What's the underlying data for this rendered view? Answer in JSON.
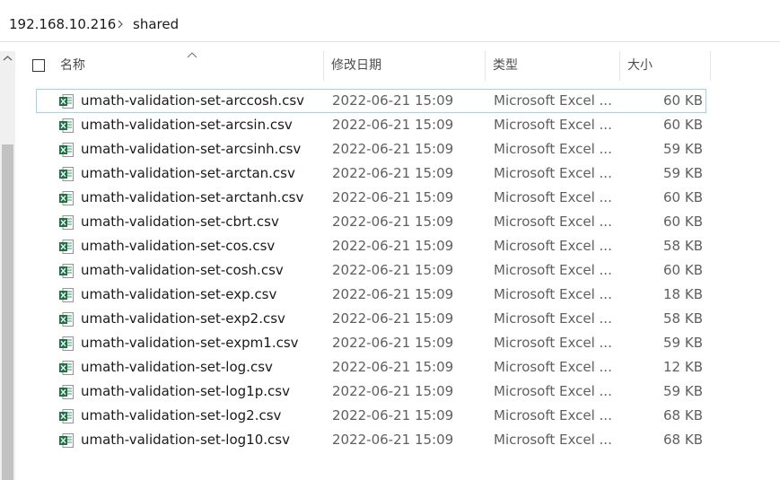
{
  "breadcrumb": {
    "items": [
      "192.168.10.216",
      "shared"
    ]
  },
  "columns": {
    "name": "名称",
    "date": "修改日期",
    "type": "类型",
    "size": "大小"
  },
  "files": [
    {
      "name": "umath-validation-set-arccosh.csv",
      "date": "2022-06-21 15:09",
      "type": "Microsoft Excel ...",
      "size": "60 KB"
    },
    {
      "name": "umath-validation-set-arcsin.csv",
      "date": "2022-06-21 15:09",
      "type": "Microsoft Excel ...",
      "size": "60 KB"
    },
    {
      "name": "umath-validation-set-arcsinh.csv",
      "date": "2022-06-21 15:09",
      "type": "Microsoft Excel ...",
      "size": "59 KB"
    },
    {
      "name": "umath-validation-set-arctan.csv",
      "date": "2022-06-21 15:09",
      "type": "Microsoft Excel ...",
      "size": "59 KB"
    },
    {
      "name": "umath-validation-set-arctanh.csv",
      "date": "2022-06-21 15:09",
      "type": "Microsoft Excel ...",
      "size": "60 KB"
    },
    {
      "name": "umath-validation-set-cbrt.csv",
      "date": "2022-06-21 15:09",
      "type": "Microsoft Excel ...",
      "size": "60 KB"
    },
    {
      "name": "umath-validation-set-cos.csv",
      "date": "2022-06-21 15:09",
      "type": "Microsoft Excel ...",
      "size": "58 KB"
    },
    {
      "name": "umath-validation-set-cosh.csv",
      "date": "2022-06-21 15:09",
      "type": "Microsoft Excel ...",
      "size": "60 KB"
    },
    {
      "name": "umath-validation-set-exp.csv",
      "date": "2022-06-21 15:09",
      "type": "Microsoft Excel ...",
      "size": "18 KB"
    },
    {
      "name": "umath-validation-set-exp2.csv",
      "date": "2022-06-21 15:09",
      "type": "Microsoft Excel ...",
      "size": "58 KB"
    },
    {
      "name": "umath-validation-set-expm1.csv",
      "date": "2022-06-21 15:09",
      "type": "Microsoft Excel ...",
      "size": "59 KB"
    },
    {
      "name": "umath-validation-set-log.csv",
      "date": "2022-06-21 15:09",
      "type": "Microsoft Excel ...",
      "size": "12 KB"
    },
    {
      "name": "umath-validation-set-log1p.csv",
      "date": "2022-06-21 15:09",
      "type": "Microsoft Excel ...",
      "size": "59 KB"
    },
    {
      "name": "umath-validation-set-log2.csv",
      "date": "2022-06-21 15:09",
      "type": "Microsoft Excel ...",
      "size": "68 KB"
    },
    {
      "name": "umath-validation-set-log10.csv",
      "date": "2022-06-21 15:09",
      "type": "Microsoft Excel ...",
      "size": "68 KB"
    }
  ],
  "icons": {
    "file": "excel-csv-file-icon",
    "sort": "sort-ascending-icon",
    "separator": "chevron-right-icon",
    "scroll_up": "scroll-up-arrow-icon"
  },
  "colors": {
    "excel_green": "#1f7244",
    "selection_border": "#99d1ff",
    "scroll_thumb": "#c2c2c2"
  }
}
